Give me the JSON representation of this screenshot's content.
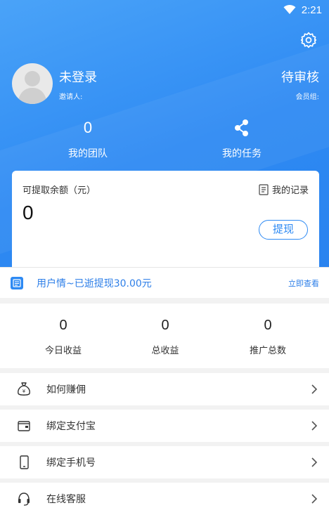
{
  "status_bar": {
    "time": "2:21",
    "wifi_icon": "wifi-icon"
  },
  "profile": {
    "name": "未登录",
    "inviter_label": "邀请人:",
    "status": "待审核",
    "member_group_label": "会员组:"
  },
  "stats": {
    "team_count": "0",
    "team_label": "我的团队",
    "task_icon": "share-icon",
    "task_label": "我的任务"
  },
  "balance_card": {
    "title": "可提取余额（元）",
    "amount": "0",
    "records_label": "我的记录",
    "withdraw_label": "提现"
  },
  "notice": {
    "text": "用户情~已逝提现30.00元",
    "view_label": "立即查看"
  },
  "earnings": [
    {
      "value": "0",
      "label": "今日收益"
    },
    {
      "value": "0",
      "label": "总收益"
    },
    {
      "value": "0",
      "label": "推广总数"
    }
  ],
  "menu": [
    {
      "label": "如何赚佣",
      "icon": "money-bag-icon"
    },
    {
      "label": "绑定支付宝",
      "icon": "wallet-icon"
    },
    {
      "label": "绑定手机号",
      "icon": "phone-icon"
    },
    {
      "label": "在线客服",
      "icon": "headset-icon"
    }
  ],
  "colors": {
    "primary": "#2e8af3",
    "background": "#f2f2f2"
  }
}
